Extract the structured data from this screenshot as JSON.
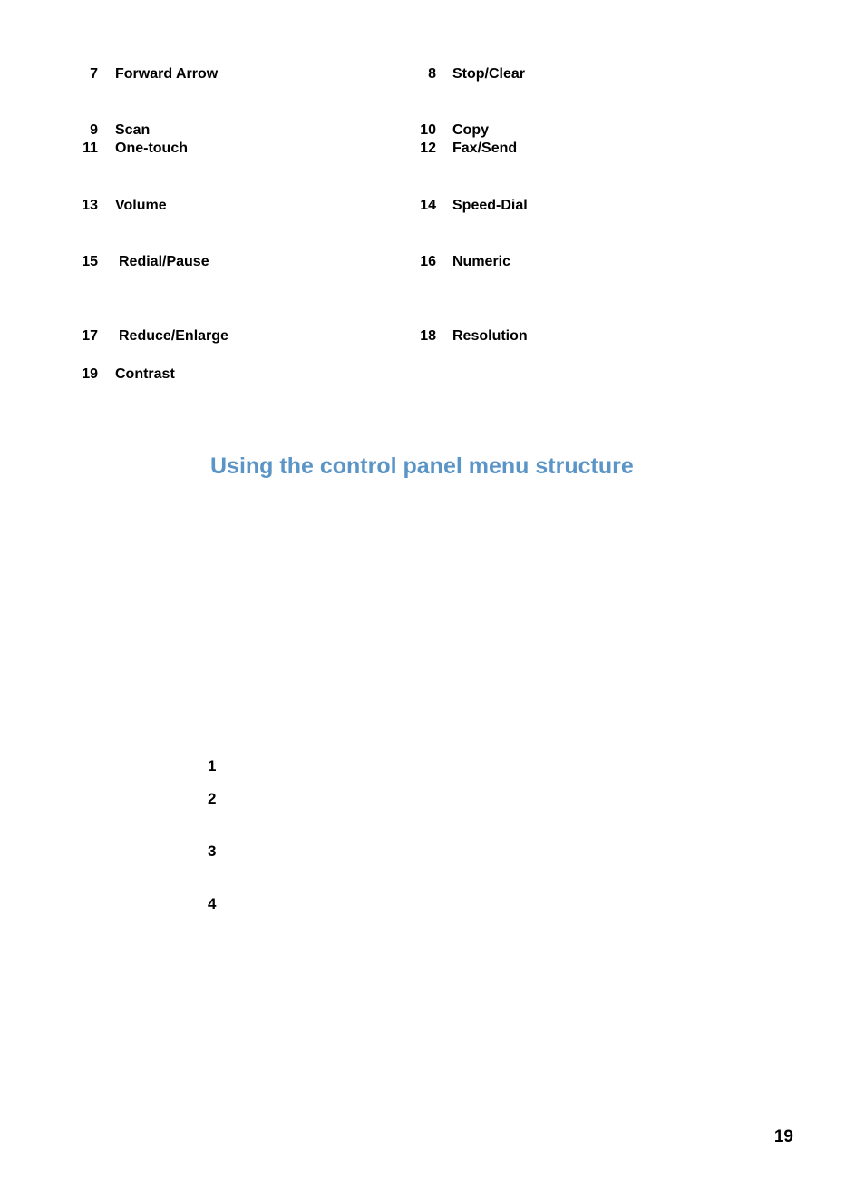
{
  "items": {
    "n7": {
      "num": "7",
      "label": "Forward Arrow"
    },
    "n8": {
      "num": "8",
      "label": "Stop/Clear"
    },
    "n9": {
      "num": "9",
      "label": "Scan"
    },
    "n10": {
      "num": "10",
      "label": "Copy"
    },
    "n11": {
      "num": "11",
      "label": "One-touch"
    },
    "n12": {
      "num": "12",
      "label": "Fax/Send"
    },
    "n13": {
      "num": "13",
      "label": "Volume"
    },
    "n14": {
      "num": "14",
      "label": "Speed-Dial"
    },
    "n15": {
      "num": "15",
      "label": "Redial/Pause"
    },
    "n16": {
      "num": "16",
      "label": "Numeric"
    },
    "n17": {
      "num": "17",
      "label": "Reduce/Enlarge"
    },
    "n18": {
      "num": "18",
      "label": "Resolution"
    },
    "n19": {
      "num": "19",
      "label": "Contrast"
    }
  },
  "heading": "Using the control panel menu structure",
  "steps": {
    "s1": "1",
    "s2": "2",
    "s3": "3",
    "s4": "4"
  },
  "page_number": "19"
}
